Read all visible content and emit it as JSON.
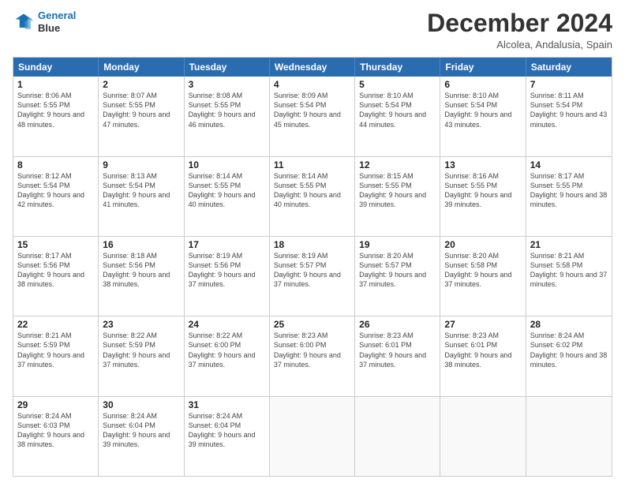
{
  "header": {
    "logo_line1": "General",
    "logo_line2": "Blue",
    "month_title": "December 2024",
    "location": "Alcolea, Andalusia, Spain"
  },
  "weekdays": [
    "Sunday",
    "Monday",
    "Tuesday",
    "Wednesday",
    "Thursday",
    "Friday",
    "Saturday"
  ],
  "weeks": [
    [
      {
        "day": "1",
        "sunrise": "8:06 AM",
        "sunset": "5:55 PM",
        "daylight": "9 hours and 48 minutes."
      },
      {
        "day": "2",
        "sunrise": "8:07 AM",
        "sunset": "5:55 PM",
        "daylight": "9 hours and 47 minutes."
      },
      {
        "day": "3",
        "sunrise": "8:08 AM",
        "sunset": "5:55 PM",
        "daylight": "9 hours and 46 minutes."
      },
      {
        "day": "4",
        "sunrise": "8:09 AM",
        "sunset": "5:54 PM",
        "daylight": "9 hours and 45 minutes."
      },
      {
        "day": "5",
        "sunrise": "8:10 AM",
        "sunset": "5:54 PM",
        "daylight": "9 hours and 44 minutes."
      },
      {
        "day": "6",
        "sunrise": "8:10 AM",
        "sunset": "5:54 PM",
        "daylight": "9 hours and 43 minutes."
      },
      {
        "day": "7",
        "sunrise": "8:11 AM",
        "sunset": "5:54 PM",
        "daylight": "9 hours and 43 minutes."
      }
    ],
    [
      {
        "day": "8",
        "sunrise": "8:12 AM",
        "sunset": "5:54 PM",
        "daylight": "9 hours and 42 minutes."
      },
      {
        "day": "9",
        "sunrise": "8:13 AM",
        "sunset": "5:54 PM",
        "daylight": "9 hours and 41 minutes."
      },
      {
        "day": "10",
        "sunrise": "8:14 AM",
        "sunset": "5:55 PM",
        "daylight": "9 hours and 40 minutes."
      },
      {
        "day": "11",
        "sunrise": "8:14 AM",
        "sunset": "5:55 PM",
        "daylight": "9 hours and 40 minutes."
      },
      {
        "day": "12",
        "sunrise": "8:15 AM",
        "sunset": "5:55 PM",
        "daylight": "9 hours and 39 minutes."
      },
      {
        "day": "13",
        "sunrise": "8:16 AM",
        "sunset": "5:55 PM",
        "daylight": "9 hours and 39 minutes."
      },
      {
        "day": "14",
        "sunrise": "8:17 AM",
        "sunset": "5:55 PM",
        "daylight": "9 hours and 38 minutes."
      }
    ],
    [
      {
        "day": "15",
        "sunrise": "8:17 AM",
        "sunset": "5:56 PM",
        "daylight": "9 hours and 38 minutes."
      },
      {
        "day": "16",
        "sunrise": "8:18 AM",
        "sunset": "5:56 PM",
        "daylight": "9 hours and 38 minutes."
      },
      {
        "day": "17",
        "sunrise": "8:19 AM",
        "sunset": "5:56 PM",
        "daylight": "9 hours and 37 minutes."
      },
      {
        "day": "18",
        "sunrise": "8:19 AM",
        "sunset": "5:57 PM",
        "daylight": "9 hours and 37 minutes."
      },
      {
        "day": "19",
        "sunrise": "8:20 AM",
        "sunset": "5:57 PM",
        "daylight": "9 hours and 37 minutes."
      },
      {
        "day": "20",
        "sunrise": "8:20 AM",
        "sunset": "5:58 PM",
        "daylight": "9 hours and 37 minutes."
      },
      {
        "day": "21",
        "sunrise": "8:21 AM",
        "sunset": "5:58 PM",
        "daylight": "9 hours and 37 minutes."
      }
    ],
    [
      {
        "day": "22",
        "sunrise": "8:21 AM",
        "sunset": "5:59 PM",
        "daylight": "9 hours and 37 minutes."
      },
      {
        "day": "23",
        "sunrise": "8:22 AM",
        "sunset": "5:59 PM",
        "daylight": "9 hours and 37 minutes."
      },
      {
        "day": "24",
        "sunrise": "8:22 AM",
        "sunset": "6:00 PM",
        "daylight": "9 hours and 37 minutes."
      },
      {
        "day": "25",
        "sunrise": "8:23 AM",
        "sunset": "6:00 PM",
        "daylight": "9 hours and 37 minutes."
      },
      {
        "day": "26",
        "sunrise": "8:23 AM",
        "sunset": "6:01 PM",
        "daylight": "9 hours and 37 minutes."
      },
      {
        "day": "27",
        "sunrise": "8:23 AM",
        "sunset": "6:01 PM",
        "daylight": "9 hours and 38 minutes."
      },
      {
        "day": "28",
        "sunrise": "8:24 AM",
        "sunset": "6:02 PM",
        "daylight": "9 hours and 38 minutes."
      }
    ],
    [
      {
        "day": "29",
        "sunrise": "8:24 AM",
        "sunset": "6:03 PM",
        "daylight": "9 hours and 38 minutes."
      },
      {
        "day": "30",
        "sunrise": "8:24 AM",
        "sunset": "6:04 PM",
        "daylight": "9 hours and 39 minutes."
      },
      {
        "day": "31",
        "sunrise": "8:24 AM",
        "sunset": "6:04 PM",
        "daylight": "9 hours and 39 minutes."
      },
      {
        "day": "",
        "sunrise": "",
        "sunset": "",
        "daylight": ""
      },
      {
        "day": "",
        "sunrise": "",
        "sunset": "",
        "daylight": ""
      },
      {
        "day": "",
        "sunrise": "",
        "sunset": "",
        "daylight": ""
      },
      {
        "day": "",
        "sunrise": "",
        "sunset": "",
        "daylight": ""
      }
    ]
  ]
}
